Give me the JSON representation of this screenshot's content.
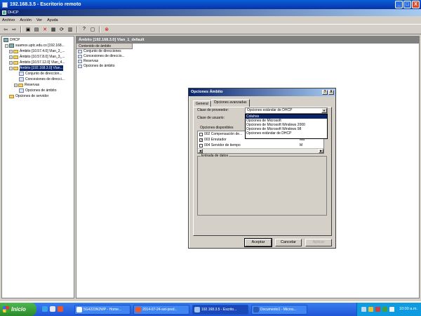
{
  "remote_window": {
    "title": "192.168.3.5 - Escritorio remoto",
    "buttons": [
      "_",
      "□",
      "X"
    ]
  },
  "app": {
    "title": "DHCP",
    "menu": [
      "Archivo",
      "Acción",
      "Ver",
      "Ayuda"
    ],
    "toolbar_icons": [
      "back-icon",
      "forward-icon",
      "up-icon",
      "show-tree-icon",
      "delete-icon",
      "properties-icon",
      "refresh-icon",
      "export-icon",
      "help-icon",
      "console-icon",
      "stop-icon"
    ]
  },
  "tree": {
    "items": [
      {
        "label": "DHCP",
        "level": 0,
        "kind": "root"
      },
      {
        "label": "suamox.uptc.edu.co [192.168...",
        "level": 1,
        "kind": "server",
        "exp": "−"
      },
      {
        "label": "Ámbito [10.57.4.0] Vlan_2_...",
        "level": 2,
        "kind": "folder",
        "exp": "+"
      },
      {
        "label": "Ámbito [10.57.8.0] Vlan_3_...",
        "level": 2,
        "kind": "folder",
        "exp": "+"
      },
      {
        "label": "Ámbito [10.57.12.0] Vlan_4...",
        "level": 2,
        "kind": "folder",
        "exp": "+"
      },
      {
        "label": "Ámbito [192.168.3.0] Vlan...",
        "level": 2,
        "kind": "folder",
        "exp": "−",
        "selected": true
      },
      {
        "label": "Conjunto de direccion...",
        "level": 3,
        "kind": "leaf"
      },
      {
        "label": "Concesiones de direcci...",
        "level": 3,
        "kind": "leaf"
      },
      {
        "label": "Reservas",
        "level": 3,
        "kind": "folder",
        "exp": "+"
      },
      {
        "label": "Opciones de ámbito",
        "level": 3,
        "kind": "leaf"
      },
      {
        "label": "Opciones de servidor",
        "level": 2,
        "kind": "folder"
      }
    ]
  },
  "right_pane": {
    "header": "Ámbito [192.168.3.0] Vlan_1_default",
    "column": "Contenido de ámbito",
    "items": [
      "Conjunto de direcciones",
      "Concesiones de direccio...",
      "Reservas",
      "Opciones de ámbito"
    ]
  },
  "dialog": {
    "title": "Opciones Ámbito",
    "help": "?",
    "close": "X",
    "tabs": [
      "General",
      "Opciones avanzadas"
    ],
    "active_tab": 1,
    "vendor_label": "Clase de proveedor:",
    "vendor_value": "Opciones estándar de DHCP",
    "user_label": "Clase de usuario:",
    "dropdown_options": [
      "Coluhss",
      "Opciones de Microsoft",
      "Opciones de Microsoft Windows 2000",
      "Opciones de Microsoft Windows 98",
      "Opciones estándar de DHCP"
    ],
    "dropdown_highlight": 0,
    "available_options_label": "Opciones disponibles",
    "options": [
      {
        "label": "002 Compensación de...",
        "checked": false,
        "desc": ""
      },
      {
        "label": "003 Enrutador",
        "checked": true,
        "desc": "Ma"
      },
      {
        "label": "004 Servidor de tiempo",
        "checked": false,
        "desc": "M"
      }
    ],
    "data_entry_label": "Entrada de datos",
    "buttons": {
      "ok": "Aceptar",
      "cancel": "Cancelar",
      "apply": "Aplicar"
    }
  },
  "taskbar": {
    "start": "Inicio",
    "tasks": [
      "5G4223N2WP - Home...",
      "2014-07-24-set-pred...",
      "192.168.3.5 - Escrito...",
      "Documento1 - Micros..."
    ],
    "active_task": 2,
    "clock": "10:00 a.m."
  }
}
